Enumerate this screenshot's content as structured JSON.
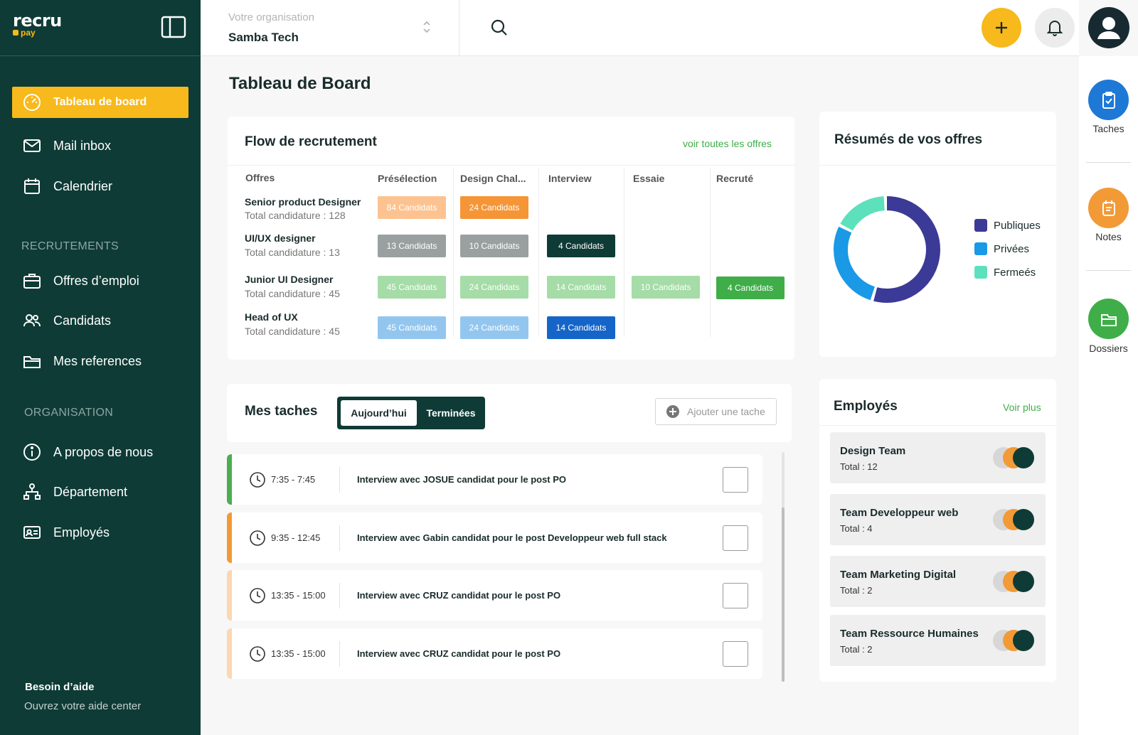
{
  "brand": {
    "name": "recru",
    "sub": "pay"
  },
  "sidebar": {
    "items": [
      {
        "label": "Tableau de board"
      },
      {
        "label": "Mail inbox"
      },
      {
        "label": "Calendrier"
      },
      {
        "label": "Offres d’emploi"
      },
      {
        "label": "Candidats"
      },
      {
        "label": "Mes references"
      },
      {
        "label": "A propos de nous"
      },
      {
        "label": "Département"
      },
      {
        "label": "Employés"
      }
    ],
    "sections": {
      "recrutements": "RECRUTEMENTS",
      "organisation": "ORGANISATION"
    },
    "help": {
      "title": "Besoin d’aide",
      "subtitle": "Ouvrez votre aide center"
    }
  },
  "topbar": {
    "org_label": "Votre organisation",
    "org_value": "Samba Tech"
  },
  "rail": {
    "taches": "Taches",
    "notes": "Notes",
    "dossiers": "Dossiers"
  },
  "page_title": "Tableau de Board",
  "flow": {
    "title": "Flow de recrutement",
    "link": "voir toutes les offres",
    "columns": [
      "Offres",
      "Présélection",
      "Design Chal...",
      "Interview",
      "Essaie",
      "Recruté"
    ],
    "offers": [
      {
        "name": "Senior product Designer",
        "total": "Total candidature : 128",
        "pills": [
          "84 Candidats",
          "24 Candidats"
        ]
      },
      {
        "name": "UI/UX designer",
        "total": "Total candidature : 13",
        "pills": [
          "13  Candidats",
          "10  Candidats",
          "4   Candidats"
        ]
      },
      {
        "name": "Junior UI Designer",
        "total": "Total candidature : 45",
        "pills": [
          "45 Candidats",
          "24 Candidats",
          "14  Candidats",
          "10  Candidats",
          "4   Candidats"
        ]
      },
      {
        "name": "Head of UX",
        "total": "Total candidature : 45",
        "pills": [
          "45 Candidats",
          "24 Candidats",
          "14  Candidats"
        ]
      }
    ],
    "colors": {
      "orange_light": "#fcc391",
      "orange": "#f59535",
      "grey": "#9aa0a0",
      "dark": "#0e3b36",
      "green_light": "#a5dca7",
      "green": "#3fae49",
      "blue_light": "#93c6ef",
      "blue": "#1565c8"
    }
  },
  "summary": {
    "title": "Résumés de vos offres",
    "legend": [
      {
        "label": "Publiques",
        "color": "#3b3a96"
      },
      {
        "label": "Privées",
        "color": "#1a99e6"
      },
      {
        "label": "Fermeés",
        "color": "#5de1bd"
      }
    ]
  },
  "chart_data": {
    "type": "pie",
    "categories": [
      "Publiques",
      "Privées",
      "Fermeés"
    ],
    "values": [
      55,
      28,
      17
    ],
    "title": "Résumés de vos offres"
  },
  "tasks": {
    "title": "Mes taches",
    "tab_today": "Aujourd’hui",
    "tab_done": "Terminées",
    "add_label": "Ajouter une tache",
    "items": [
      {
        "time": "7:35 - 7:45",
        "text": "Interview avec JOSUE candidat pour le post PO",
        "color": "#4cae4f"
      },
      {
        "time": "9:35 - 12:45",
        "text": "Interview avec Gabin candidat pour le post Developpeur web full stack",
        "color": "#f29a36"
      },
      {
        "time": "13:35 - 15:00",
        "text": "Interview avec CRUZ candidat pour le post PO",
        "color": "#fcd7b0"
      },
      {
        "time": "13:35 - 15:00",
        "text": "Interview avec CRUZ candidat pour le post PO",
        "color": "#fcd7b0"
      }
    ]
  },
  "employees": {
    "title": "Employés",
    "link": "Voir plus",
    "items": [
      {
        "name": "Design Team",
        "total": "Total : 12"
      },
      {
        "name": "Team Developpeur web",
        "total": "Total : 4"
      },
      {
        "name": "Team Marketing Digital",
        "total": "Total : 2"
      },
      {
        "name": "Team Ressource Humaines",
        "total": "Total : 2"
      }
    ]
  }
}
